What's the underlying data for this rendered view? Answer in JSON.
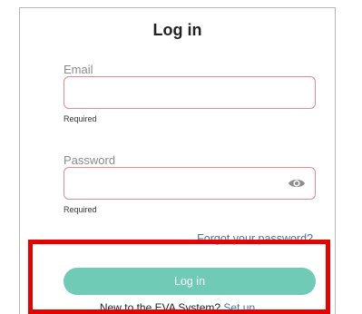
{
  "title": "Log in",
  "email": {
    "label": "Email",
    "value": "",
    "hint": "Required"
  },
  "password": {
    "label": "Password",
    "value": "",
    "hint": "Required"
  },
  "forgot_link": "Forgot your password?",
  "login_button": "Log in",
  "signup": {
    "text": "New to the EVA System?",
    "link": "Set up"
  },
  "colors": {
    "field_border": "#e08a96",
    "button": "#6fcbb5",
    "link": "#4a6fa5",
    "highlight": "#e60000"
  },
  "icons": {
    "password_toggle": "eye-icon"
  }
}
